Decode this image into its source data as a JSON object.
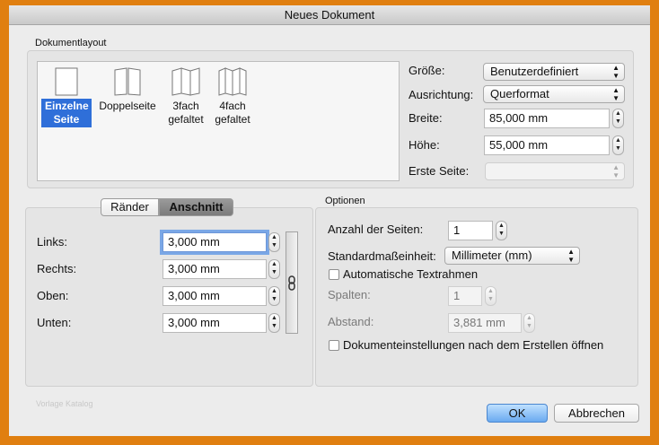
{
  "window": {
    "title": "Neues Dokument"
  },
  "layout_section": {
    "label": "Dokumentlayout",
    "items": [
      {
        "label_line1": "Einzelne",
        "label_line2": "Seite",
        "selected": true,
        "icon": "single-page-icon"
      },
      {
        "label_line1": "Doppelseite",
        "label_line2": "",
        "selected": false,
        "icon": "double-page-icon"
      },
      {
        "label_line1": "3fach",
        "label_line2": "gefaltet",
        "selected": false,
        "icon": "trifold-icon"
      },
      {
        "label_line1": "4fach",
        "label_line2": "gefaltet",
        "selected": false,
        "icon": "fourfold-icon"
      }
    ],
    "size_label": "Größe:",
    "size_value": "Benutzerdefiniert",
    "orientation_label": "Ausrichtung:",
    "orientation_value": "Querformat",
    "width_label": "Breite:",
    "width_value": "85,000 mm",
    "height_label": "Höhe:",
    "height_value": "55,000 mm",
    "first_page_label": "Erste Seite:",
    "first_page_value": ""
  },
  "margins_panel": {
    "tabs": [
      "Ränder",
      "Anschnitt"
    ],
    "active_tab": "Anschnitt",
    "rows": [
      {
        "label": "Links:",
        "value": "3,000 mm"
      },
      {
        "label": "Rechts:",
        "value": "3,000 mm"
      },
      {
        "label": "Oben:",
        "value": "3,000 mm"
      },
      {
        "label": "Unten:",
        "value": "3,000 mm"
      }
    ],
    "link_icon": "chain-link-icon"
  },
  "options_panel": {
    "label": "Optionen",
    "page_count_label": "Anzahl der Seiten:",
    "page_count_value": "1",
    "unit_label": "Standardmaßeinheit:",
    "unit_value": "Millimeter (mm)",
    "auto_text_frames_label": "Automatische Textrahmen",
    "auto_text_frames_checked": false,
    "columns_label": "Spalten:",
    "columns_value": "1",
    "gap_label": "Abstand:",
    "gap_value": "3,881 mm",
    "open_settings_label": "Dokumenteinstellungen nach dem Erstellen öffnen",
    "open_settings_checked": false
  },
  "footer": {
    "template_hint": "Vorlage Katalog",
    "ok_label": "OK",
    "cancel_label": "Abbrechen"
  },
  "colors": {
    "background": "#e07f10",
    "selection": "#2f6fd9",
    "default_button": "#6aaaf0"
  }
}
